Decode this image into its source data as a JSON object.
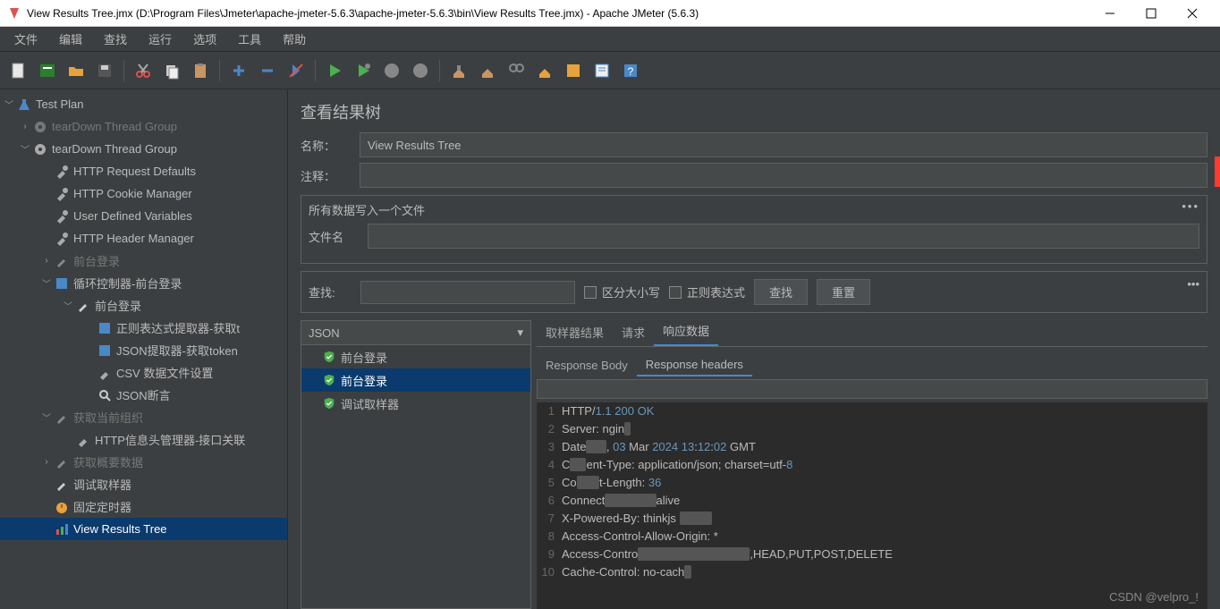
{
  "window": {
    "title": "View Results Tree.jmx (D:\\Program Files\\Jmeter\\apache-jmeter-5.6.3\\apache-jmeter-5.6.3\\bin\\View Results Tree.jmx) - Apache JMeter (5.6.3)"
  },
  "menu": [
    "文件",
    "编辑",
    "查找",
    "运行",
    "选项",
    "工具",
    "帮助"
  ],
  "tree": {
    "root": "Test Plan",
    "items": [
      {
        "label": "tearDown Thread Group",
        "dimmed": true
      },
      {
        "label": "tearDown Thread Group"
      },
      {
        "label": "HTTP Request Defaults"
      },
      {
        "label": "HTTP Cookie Manager"
      },
      {
        "label": "User Defined Variables"
      },
      {
        "label": "HTTP Header Manager"
      },
      {
        "label": "前台登录",
        "dimmed": true
      },
      {
        "label": "循环控制器-前台登录"
      },
      {
        "label": "前台登录"
      },
      {
        "label": "正则表达式提取器-获取t"
      },
      {
        "label": "JSON提取器-获取token"
      },
      {
        "label": "CSV 数据文件设置"
      },
      {
        "label": "JSON断言"
      },
      {
        "label": "获取当前组织",
        "dimmed": true
      },
      {
        "label": "HTTP信息头管理器-接口关联"
      },
      {
        "label": "获取概要数据",
        "dimmed": true
      },
      {
        "label": "调试取样器"
      },
      {
        "label": "固定定时器"
      },
      {
        "label": "View Results Tree"
      }
    ]
  },
  "panel": {
    "title": "查看结果树",
    "name_label": "名称：",
    "name_value": "View Results Tree",
    "comment_label": "注释：",
    "comment_value": "",
    "file_group_title": "所有数据写入一个文件",
    "file_label": "文件名",
    "file_value": "",
    "search_label": "查找:",
    "search_value": "",
    "case_label": "区分大小写",
    "regex_label": "正则表达式",
    "search_btn": "查找",
    "reset_btn": "重置"
  },
  "results": {
    "combo": "JSON",
    "samples": [
      "前台登录",
      "前台登录",
      "调试取样器"
    ],
    "tabs": [
      "取样器结果",
      "请求",
      "响应数据"
    ],
    "active_tab": 2,
    "subtabs": [
      "Response Body",
      "Response headers"
    ],
    "active_subtab": 1
  },
  "code": {
    "lines": [
      {
        "n": "1",
        "html": "HTTP/<span class='tok-num'>1.1</span> <span class='tok-num'>200</span> <span class='tok-num'>OK</span>"
      },
      {
        "n": "2",
        "html": "Server: ngin<span class='tok-smudge'>x</span>"
      },
      {
        "n": "3",
        "html": "Date<span class='tok-smudge'>: Fri</span>, <span class='tok-num'>03</span> Mar <span class='tok-num'>2024</span> <span class='tok-num'>13</span>:<span class='tok-num'>12</span>:<span class='tok-num'>02</span> GMT"
      },
      {
        "n": "4",
        "html": "C<span class='tok-smudge'>ont</span>ent-Type: application/json; charset=utf-<span class='tok-num'>8</span>"
      },
      {
        "n": "5",
        "html": "Co<span class='tok-smudge'>nten</span>t-Length: <span class='tok-num'>36</span>"
      },
      {
        "n": "6",
        "html": "Connect<span class='tok-smudge'>ion: keep-</span>alive"
      },
      {
        "n": "7",
        "html": "X-Powered-By: thinkjs <span class='tok-smudge'>3.2.13</span>"
      },
      {
        "n": "8",
        "html": "Access-Control-Allow-Origin: *"
      },
      {
        "n": "9",
        "html": "Access-Contro<span class='tok-smudge'>l-Allow-Methods: GET</span>,HEAD,PUT,POST,DELETE"
      },
      {
        "n": "10",
        "html": "Cache-Control: no-cach<span class='tok-smudge'>e</span>"
      }
    ]
  },
  "watermark": "CSDN @velpro_!"
}
